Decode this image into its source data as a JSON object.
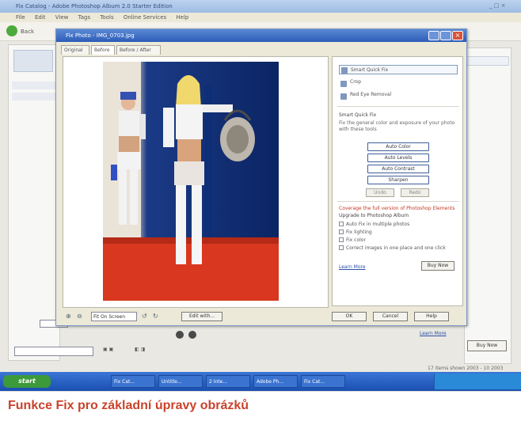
{
  "caption": "Funkce Fix pro základní úpravy obrázků",
  "dialog": {
    "title": "Fix Photo - IMG_0703.jpg",
    "tabs": [
      "Original",
      "Before",
      "Before / After"
    ],
    "side": {
      "smart_fix": "Smart Quick Fix",
      "crop": "Crop",
      "red_eye": "Red Eye Removal",
      "auto_fix_head": "Smart Quick Fix",
      "auto_fix_text": "Fix the general color and exposure of your photo with these tools",
      "buttons": [
        "Auto Color",
        "Auto Levels",
        "Auto Contrast",
        "Sharpen"
      ],
      "undo": "Undo",
      "redo": "Redo",
      "upgrade_head": "Coverage the full version of Photoshop Elements",
      "upgrade_sub": "Upgrade to Photoshop Album",
      "features": [
        "Auto Fix in multiple photos",
        "Fix lighting",
        "Fix color",
        "Correct images in one place and one click"
      ],
      "learn_more": "Learn More",
      "buy_now": "Buy Now"
    },
    "bottom": {
      "fit": "Fit On Screen",
      "help": "Help",
      "ok": "OK",
      "cancel": "Cancel",
      "edit_with": "Edit with..."
    }
  },
  "app": {
    "title": "Fix Catalog - Adobe Photoshop Album 2.0 Starter Edition",
    "menu": [
      "File",
      "Edit",
      "View",
      "Tags",
      "Tools",
      "Online Services",
      "Help"
    ],
    "back": "Back",
    "status_date": "17 items shown 2003 - 10 2003",
    "learn_more": "Learn More",
    "buy_now": "Buy Now"
  },
  "taskbar": {
    "start": "start",
    "items": [
      "Fix Cat...",
      "Untitle...",
      "2 Inte...",
      "Adobe Ph...",
      "Fix Cat..."
    ]
  }
}
